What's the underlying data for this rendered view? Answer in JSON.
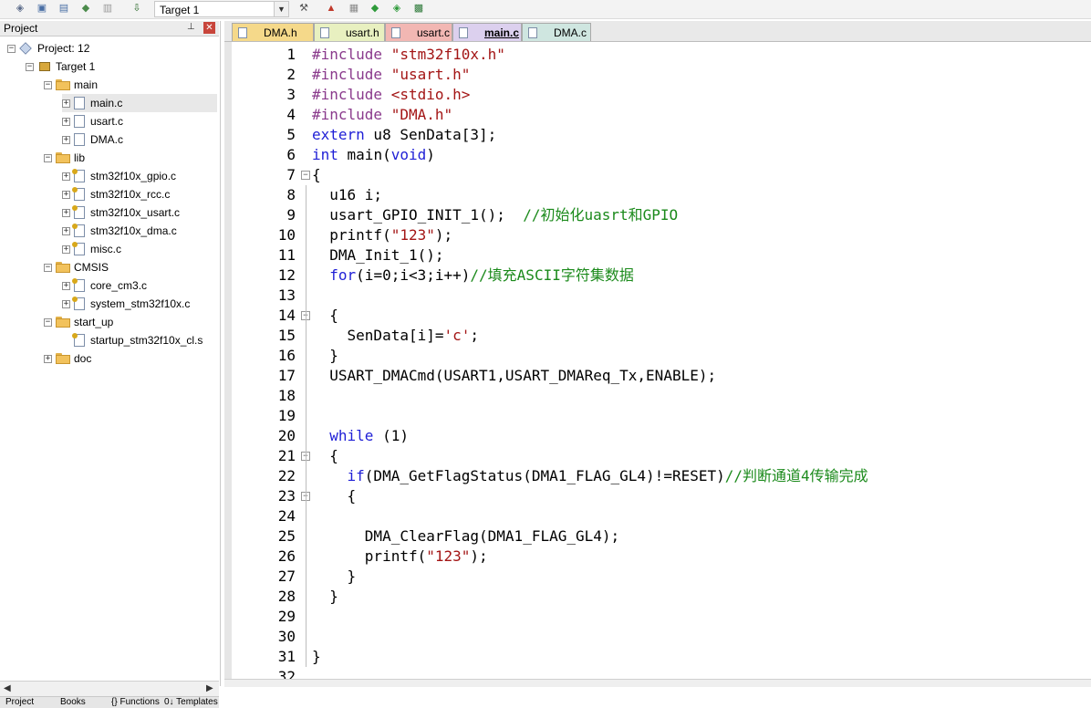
{
  "toolbar": {
    "target_select": "Target 1",
    "icons": [
      "batch-build-icon",
      "translate-icon",
      "build-icon",
      "rebuild-icon",
      "stop-build-icon",
      "load-icon",
      "options-icon",
      "manage-components-icon",
      "pack-installer-icon",
      "select-software-packs-icon",
      "run-environment-icon",
      "debug-icon"
    ]
  },
  "project_panel": {
    "title": "Project",
    "pin_glyph": "⊥",
    "close_glyph": "✕",
    "tree": {
      "project": "Project: 12",
      "target": "Target 1",
      "groups": [
        {
          "name": "main",
          "files": [
            "main.c",
            "usart.c",
            "DMA.c"
          ]
        },
        {
          "name": "lib",
          "files": [
            "stm32f10x_gpio.c",
            "stm32f10x_rcc.c",
            "stm32f10x_usart.c",
            "stm32f10x_dma.c",
            "misc.c"
          ]
        },
        {
          "name": "CMSIS",
          "files": [
            "core_cm3.c",
            "system_stm32f10x.c"
          ]
        },
        {
          "name": "start_up",
          "files": [
            "startup_stm32f10x_cl.s"
          ]
        },
        {
          "name": "doc",
          "files": []
        }
      ]
    },
    "bottom_tabs": [
      "Project",
      "Books",
      "{} Functions",
      "0↓ Templates"
    ]
  },
  "editor": {
    "tabs": [
      {
        "label": "DMA.h",
        "color": "#f5d98a"
      },
      {
        "label": "usart.h",
        "color": "#e8f0c0"
      },
      {
        "label": "usart.c",
        "color": "#f2b7b3"
      },
      {
        "label": "main.c",
        "color": "#dcd0ee",
        "active": true
      },
      {
        "label": "DMA.c",
        "color": "#cfe6e0"
      }
    ],
    "active_file": "main.c",
    "lines": [
      {
        "n": "1",
        "text": "#include \"stm32f10x.h\""
      },
      {
        "n": "2",
        "text": "#include \"usart.h\""
      },
      {
        "n": "3",
        "text": "#include <stdio.h>"
      },
      {
        "n": "4",
        "text": "#include \"DMA.h\""
      },
      {
        "n": "5",
        "text": "extern u8 SenData[3];"
      },
      {
        "n": "6",
        "text": "int main(void)"
      },
      {
        "n": "7",
        "text": "{"
      },
      {
        "n": "8",
        "text": "  u16 i;"
      },
      {
        "n": "9",
        "text": "  usart_GPIO_INIT_1();  //初始化uasrt和GPIO"
      },
      {
        "n": "10",
        "text": "  printf(\"123\");"
      },
      {
        "n": "11",
        "text": "  DMA_Init_1();"
      },
      {
        "n": "12",
        "text": "  for(i=0;i<3;i++)//填充ASCII字符集数据"
      },
      {
        "n": "13",
        "text": ""
      },
      {
        "n": "14",
        "text": "  {"
      },
      {
        "n": "15",
        "text": "    SenData[i]='c';"
      },
      {
        "n": "16",
        "text": "  }"
      },
      {
        "n": "17",
        "text": "  USART_DMACmd(USART1,USART_DMAReq_Tx,ENABLE);"
      },
      {
        "n": "18",
        "text": ""
      },
      {
        "n": "19",
        "text": ""
      },
      {
        "n": "20",
        "text": "  while (1)"
      },
      {
        "n": "21",
        "text": "  {"
      },
      {
        "n": "22",
        "text": "    if(DMA_GetFlagStatus(DMA1_FLAG_GL4)!=RESET)//判断通道4传输完成"
      },
      {
        "n": "23",
        "text": "    {"
      },
      {
        "n": "24",
        "text": ""
      },
      {
        "n": "25",
        "text": "      DMA_ClearFlag(DMA1_FLAG_GL4);"
      },
      {
        "n": "26",
        "text": "      printf(\"123\");"
      },
      {
        "n": "27",
        "text": "    }"
      },
      {
        "n": "28",
        "text": "  }"
      },
      {
        "n": "29",
        "text": ""
      },
      {
        "n": "30",
        "text": ""
      },
      {
        "n": "31",
        "text": "}"
      },
      {
        "n": "32",
        "text": ""
      }
    ]
  }
}
